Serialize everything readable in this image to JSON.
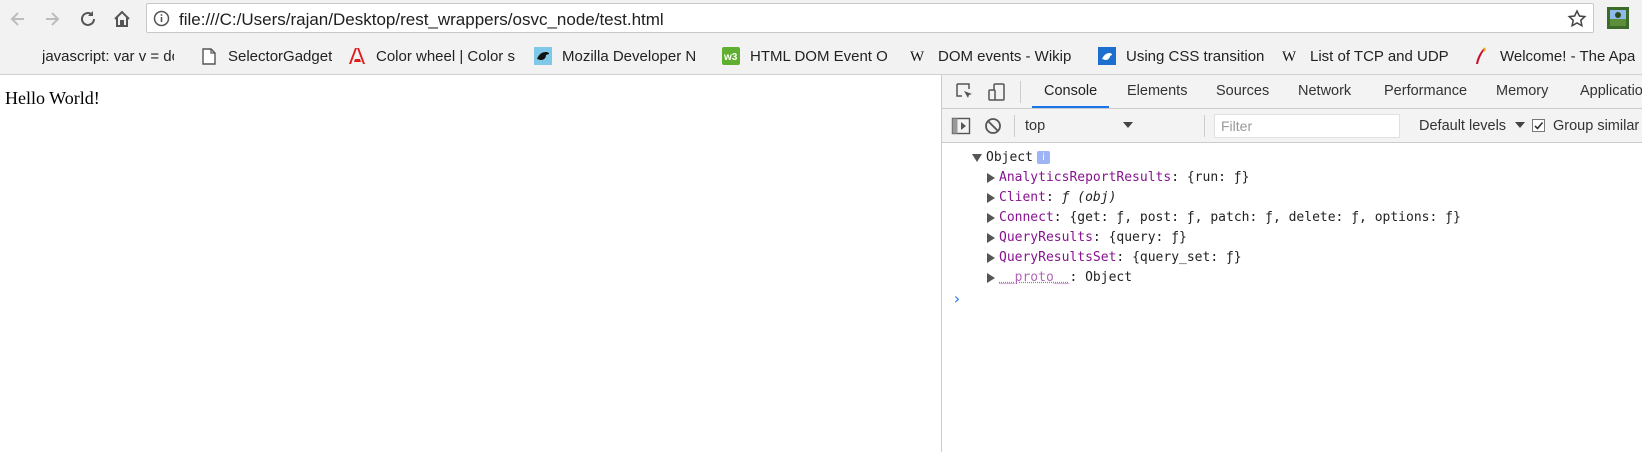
{
  "browser": {
    "url": "file:///C:/Users/rajan/Desktop/rest_wrappers/osvc_node/test.html",
    "icons": [
      "back-icon",
      "forward-icon",
      "reload-icon",
      "home-icon",
      "info-icon",
      "bookmark-star-icon",
      "extension-icon"
    ]
  },
  "bookmarks": [
    {
      "label": "javascript: var v = do",
      "icon": "blank-page-icon"
    },
    {
      "label": "SelectorGadget",
      "icon": "page-icon"
    },
    {
      "label": "Color wheel | Color s",
      "icon": "adobe-icon"
    },
    {
      "label": "Mozilla Developer N",
      "icon": "mdn-icon"
    },
    {
      "label": "HTML DOM Event O",
      "icon": "w3schools-icon"
    },
    {
      "label": "DOM events - Wikip",
      "icon": "wikipedia-icon"
    },
    {
      "label": "Using CSS transition",
      "icon": "mdn-blue-icon"
    },
    {
      "label": "List of TCP and UDP",
      "icon": "wikipedia-icon"
    },
    {
      "label": "Welcome! - The Apa",
      "icon": "apache-icon"
    }
  ],
  "page": {
    "text": "Hello World!"
  },
  "devtools": {
    "tabs": [
      "Console",
      "Elements",
      "Sources",
      "Network",
      "Performance",
      "Memory",
      "Application"
    ],
    "active_tab": "Console",
    "context": "top",
    "filter_placeholder": "Filter",
    "levels_label": "Default levels",
    "group_label": "Group similar",
    "group_checked": true
  },
  "console": {
    "root": "Object",
    "badge": "i",
    "entries": [
      {
        "key": "AnalyticsReportResults",
        "sep": ": ",
        "value": "{run: ƒ}",
        "italic": false
      },
      {
        "key": "Client",
        "sep": ": ",
        "value": "ƒ (obj)",
        "italic": true
      },
      {
        "key": "Connect",
        "sep": ": ",
        "value": "{get: ƒ, post: ƒ, patch: ƒ, delete: ƒ, options: ƒ}",
        "italic": false
      },
      {
        "key": "QueryResults",
        "sep": ": ",
        "value": "{query: ƒ}",
        "italic": false
      },
      {
        "key": "QueryResultsSet",
        "sep": ": ",
        "value": "{query_set: ƒ}",
        "italic": false
      },
      {
        "key": "__proto__",
        "sep": ": ",
        "value": "Object",
        "italic": false
      }
    ],
    "prompt": "›"
  },
  "colors": {
    "accent": "#1a73e8",
    "property": "#881391",
    "prompt": "#2e7de9"
  }
}
